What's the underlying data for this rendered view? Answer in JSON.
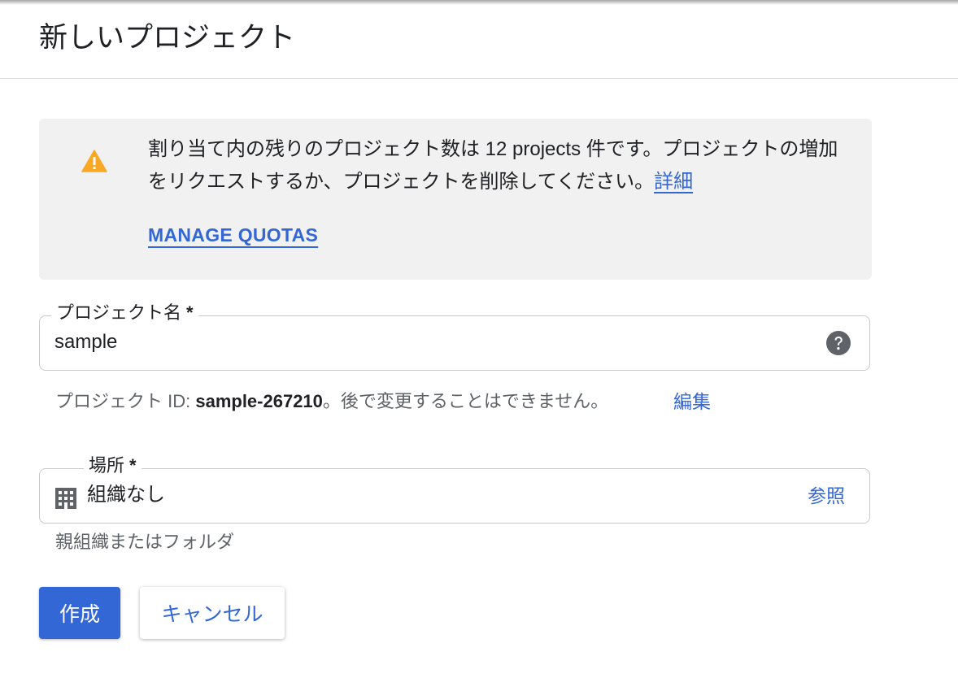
{
  "header": {
    "title": "新しいプロジェクト"
  },
  "quota_notice": {
    "icon": "warning-icon",
    "icon_color": "#f9a825",
    "message_part1": "割り当て内の残りのプロジェクト数は 12 projects 件です。プロジェクトの増加をリクエストするか、プロジェクトを削除してください。",
    "details_link": "詳細",
    "manage_quotas_link": "MANAGE QUOTAS"
  },
  "project_name_field": {
    "label": "プロジェクト名",
    "required_mark": "*",
    "value": "sample",
    "help_icon": "help-circle-icon"
  },
  "project_id": {
    "prefix": "プロジェクト ID: ",
    "id": "sample-267210",
    "suffix": "。後で変更することはできません。",
    "edit_link": "編集"
  },
  "location_field": {
    "label": "場所",
    "required_mark": "*",
    "icon": "building-icon",
    "value": "組織なし",
    "browse_link": "参照",
    "helper_text": "親組織またはフォルダ"
  },
  "actions": {
    "create_label": "作成",
    "cancel_label": "キャンセル"
  },
  "colors": {
    "accent": "#3367d6",
    "notice_background": "#f1f1f1",
    "border": "#c8c8c8",
    "secondary_text": "#5f6368"
  }
}
